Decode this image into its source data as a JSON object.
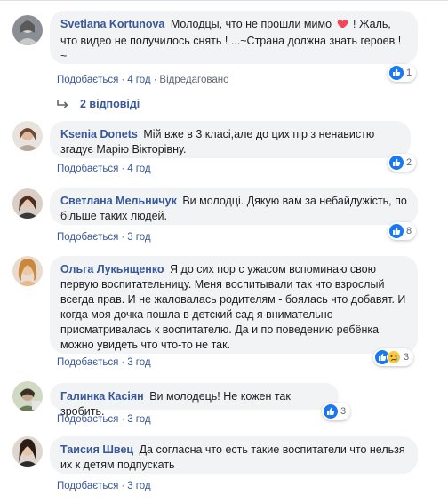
{
  "comments": [
    {
      "author": "Svetlana Kortunova",
      "text_a": "Молодцы, что не прошли мимо",
      "text_b": "!  Жаль, что видео не получилось снять !  ...~Страна должна знать героев !  ~",
      "heart_icon": "red-heart-icon",
      "like": "Подобається",
      "time": "4 год",
      "edited": "Відредаговано",
      "reactions": "1",
      "replies": "2 відповіді"
    },
    {
      "author": "Ksenia Donets",
      "text": "Мій вже в 3 класі,але до цих пір з ненавистю згадує Марію Вікторівну.",
      "like": "Подобається",
      "time": "4 год",
      "reactions": "2"
    },
    {
      "author": "Светлана Мельничук",
      "text": "Ви молодці. Дякую вам за небайдужість, по більше таких людей.",
      "like": "Подобається",
      "time": "3 год",
      "reactions": "8"
    },
    {
      "author": "Ольга Лукьященко",
      "text": "Я до сих пор с ужасом вспоминаю свою первую воспитательницу. Меня воспитывали так что взрослый всегда прав. И не жаловалась родителям - боялась что добавят. И когда моя дочка пошла в детский сад я внимательно присматривалась к воспитателю. Да и по поведению ребёнка можно увидеть что что-то не так.",
      "like": "Подобається",
      "time": "3 год",
      "reactions": "3"
    },
    {
      "author": "Галинка Касіян",
      "text": "Ви молодець! Не кожен так зробить.",
      "like": "Подобається",
      "time": "3 год",
      "reactions": "3"
    },
    {
      "author": "Таисия Швец",
      "text": "Да согласна что есть такие воспитатели что нельзя их к детям подпускать",
      "like": "Подобається",
      "time": "3 год"
    }
  ],
  "separator": "·",
  "colors": {
    "link": "#385898",
    "bubble": "#f2f3f5",
    "like_blue": "#1877f2",
    "meta": "#606770"
  }
}
